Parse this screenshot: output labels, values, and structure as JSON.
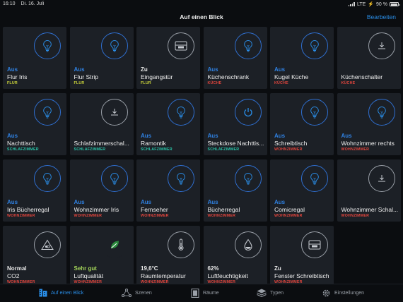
{
  "status_bar": {
    "time": "16:10",
    "date": "Di. 16. Juli",
    "network": "LTE",
    "battery": "90 %",
    "battery_level": 0.9
  },
  "nav": {
    "title": "Auf einen Blick",
    "edit_label": "Bearbeiten"
  },
  "colors": {
    "accent": "#2a8ee8",
    "flur": "#c9d23a",
    "kueche": "#e0453d",
    "schlafzimmer": "#29c4a8",
    "wohnzimmer": "#e0453d",
    "good": "#a5d65a"
  },
  "tiles": [
    {
      "status": "Aus",
      "name": "Flur Iris",
      "room": "FLUR",
      "icon": "lightbulb-icon"
    },
    {
      "status": "Aus",
      "name": "Flur Strip",
      "room": "FLUR",
      "icon": "lightbulb-icon"
    },
    {
      "status": "Zu",
      "name": "Eingangstür",
      "room": "FLUR",
      "icon": "window-sensor-icon"
    },
    {
      "status": "Aus",
      "name": "Küchenschrank",
      "room": "KÜCHE",
      "icon": "lightbulb-icon"
    },
    {
      "status": "Aus",
      "name": "Kugel Küche",
      "room": "KÜCHE",
      "icon": "lightbulb-icon"
    },
    {
      "status": "",
      "name": "Küchenschalter",
      "room": "KÜCHE",
      "icon": "switch-icon"
    },
    {
      "status": "Aus",
      "name": "Nachttisch",
      "room": "SCHLAFZIMMER",
      "icon": "lightbulb-icon"
    },
    {
      "status": "",
      "name": "Schlafzimmerschal...",
      "room": "SCHLAFZIMMER",
      "icon": "switch-icon"
    },
    {
      "status": "Aus",
      "name": "Ramontik",
      "room": "SCHLAFZIMMER",
      "icon": "lightbulb-icon"
    },
    {
      "status": "Aus",
      "name": "Steckdose Nachttis...",
      "room": "SCHLAFZIMMER",
      "icon": "power-icon"
    },
    {
      "status": "Aus",
      "name": "Schreibtisch",
      "room": "WOHNZIMMER",
      "icon": "lightbulb-icon"
    },
    {
      "status": "Aus",
      "name": "Wohnzimmer rechts",
      "room": "WOHNZIMMER",
      "icon": "lightbulb-icon"
    },
    {
      "status": "Aus",
      "name": "Iris Bücherregal",
      "room": "WOHNZIMMER",
      "icon": "lightbulb-icon"
    },
    {
      "status": "Aus",
      "name": "Wohnzimmer Iris",
      "room": "WOHNZIMMER",
      "icon": "lightbulb-icon"
    },
    {
      "status": "Aus",
      "name": "Fernseher",
      "room": "WOHNZIMMER",
      "icon": "lightbulb-icon"
    },
    {
      "status": "Aus",
      "name": "Bücherregal",
      "room": "WOHNZIMMER",
      "icon": "lightbulb-icon"
    },
    {
      "status": "Aus",
      "name": "Comicregal",
      "room": "WOHNZIMMER",
      "icon": "lightbulb-icon"
    },
    {
      "status": "",
      "name": "Wohnzimmer Schal...",
      "room": "WOHNZIMMER",
      "icon": "switch-icon"
    },
    {
      "status": "Normal",
      "name": "CO2",
      "room": "WOHNZIMMER",
      "icon": "co2-sensor-icon"
    },
    {
      "status": "Sehr gut",
      "name": "Luftqualität",
      "room": "WOHNZIMMER",
      "icon": "leaf-icon"
    },
    {
      "status": "19,6°C",
      "name": "Raumtemperatur",
      "room": "WOHNZIMMER",
      "icon": "thermometer-icon"
    },
    {
      "status": "62%",
      "name": "Luftfeuchtigkeit",
      "room": "WOHNZIMMER",
      "icon": "humidity-icon"
    },
    {
      "status": "Zu",
      "name": "Fenster Schreibtisch",
      "room": "WOHNZIMMER",
      "icon": "window-sensor-icon"
    }
  ],
  "tabs": [
    {
      "label": "Auf einen Blick",
      "icon": "dashboard-icon",
      "active": true
    },
    {
      "label": "Szenen",
      "icon": "scenes-icon",
      "active": false
    },
    {
      "label": "Räume",
      "icon": "rooms-icon",
      "active": false
    },
    {
      "label": "Typen",
      "icon": "types-icon",
      "active": false
    },
    {
      "label": "Einstellungen",
      "icon": "gear-icon",
      "active": false
    }
  ]
}
